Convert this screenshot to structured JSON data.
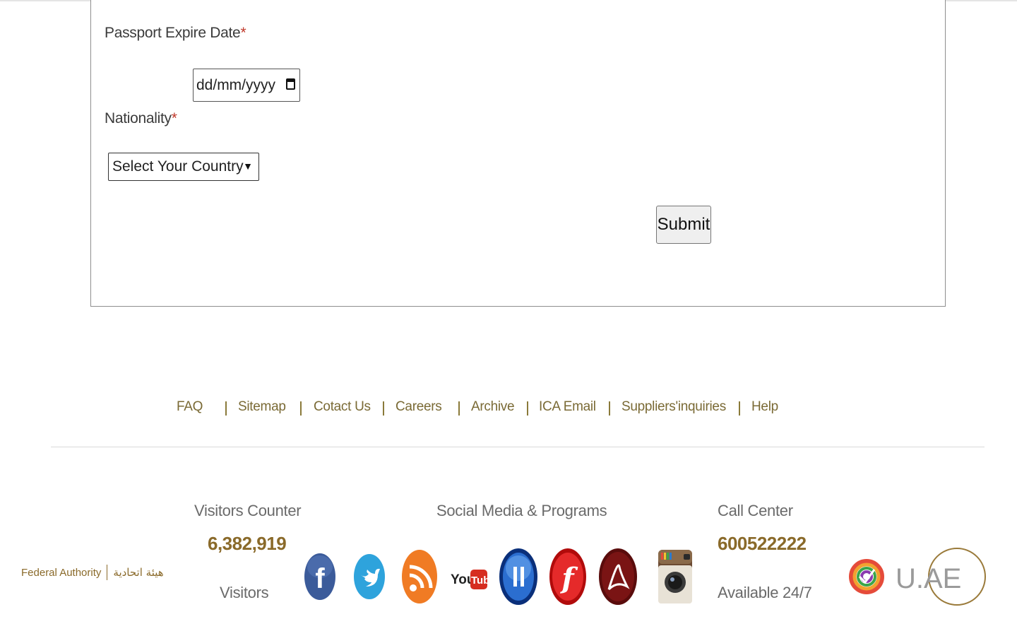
{
  "form": {
    "passport_label": "Passport Expire Date",
    "required_mark": "*",
    "date_placeholder": "dd/mm/yyyy",
    "nationality_label": "Nationality",
    "country_select_value": "Select Your Country",
    "submit_label": "Submit"
  },
  "footer_links": [
    "FAQ",
    "Sitemap",
    "Cotact Us",
    "Careers",
    "Archive",
    "ICA Email",
    "Suppliers'inquiries",
    "Help"
  ],
  "federal_logo": {
    "en": "Federal Authority",
    "ar": "هيئة اتحادية"
  },
  "visitors": {
    "title": "Visitors Counter",
    "count": "6,382,919",
    "label": "Visitors"
  },
  "social": {
    "title": "Social Media & Programs",
    "icons": [
      "facebook-icon",
      "twitter-icon",
      "rss-icon",
      "youtube-icon",
      "media-player-icon",
      "flash-player-icon",
      "adobe-reader-icon",
      "instagram-icon"
    ]
  },
  "call_center": {
    "title": "Call Center",
    "number": "600522222",
    "availability": "Available 24/7"
  },
  "uae_logo": {
    "text": "U.AE"
  },
  "colors": {
    "gold": "#8a6a2a",
    "link": "#7a6a35",
    "required": "#c0392b"
  }
}
